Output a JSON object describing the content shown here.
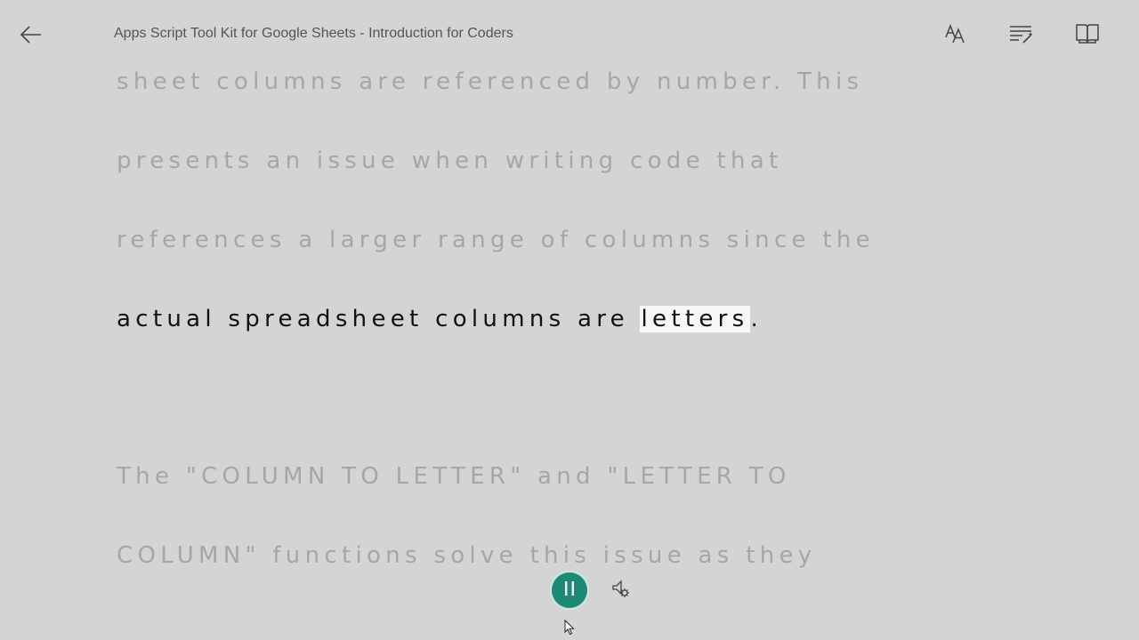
{
  "header": {
    "back_icon": "arrow-left-icon",
    "title": "Apps Script Tool Kit for Google Sheets - Introduction for Coders",
    "tools": [
      {
        "icon": "text-options-icon",
        "label": "Text options"
      },
      {
        "icon": "grammar-tools-icon",
        "label": "Grammar tools"
      },
      {
        "icon": "reading-preferences-icon",
        "label": "Reading preferences"
      }
    ]
  },
  "reading": {
    "lines": [
      "sheet columns are referenced by number. This",
      "presents an issue when writing code that",
      "references a larger range of columns since the"
    ],
    "current_line": {
      "before": "actual spreadsheet columns are ",
      "highlighted_word": "letters",
      "after": "."
    },
    "next_lines": [
      "The \"COLUMN TO LETTER\" and \"LETTER TO",
      "COLUMN\" functions solve this issue as they"
    ]
  },
  "playback": {
    "pause_icon": "pause-icon",
    "voice_settings_icon": "voice-settings-icon",
    "state": "playing"
  },
  "colors": {
    "background": "#d4d4d4",
    "dim_text": "#a6a6a6",
    "active_text": "#111111",
    "word_highlight": "#f7f7f7",
    "accent": "#1d8a78"
  }
}
